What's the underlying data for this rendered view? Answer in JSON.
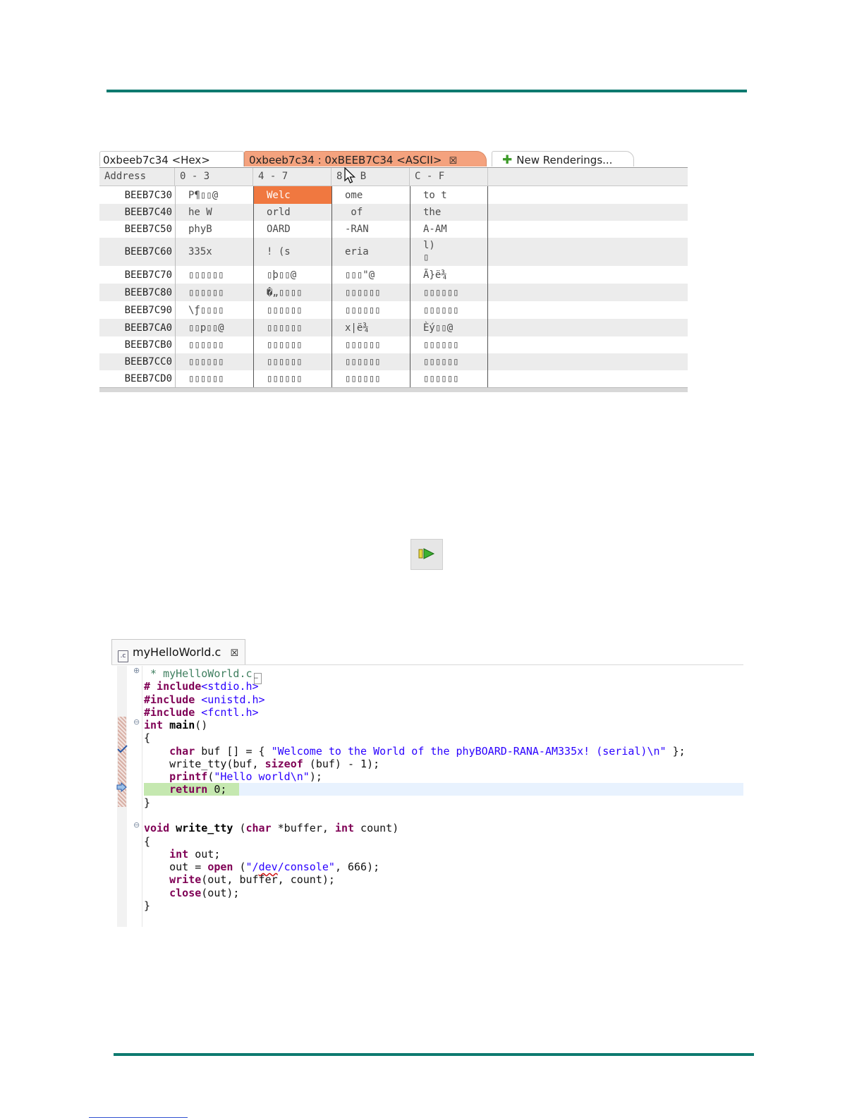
{
  "memory_view": {
    "tabs": [
      {
        "label": "0xbeeb7c34 <Hex>"
      },
      {
        "label": "0xbeeb7c34 : 0xBEEB7C34 <ASCII>"
      },
      {
        "label": "New Renderings..."
      }
    ],
    "columns": [
      "Address",
      "0 - 3",
      "4 - 7",
      "8 - B",
      "C - F"
    ],
    "rows": [
      {
        "address": "BEEB7C30",
        "c0": "P¶▯▯@",
        "c1": "Welc",
        "c2": "ome",
        "c3": "to t"
      },
      {
        "address": "BEEB7C40",
        "c0": "he W",
        "c1": "orld",
        "c2": " of",
        "c3": "the"
      },
      {
        "address": "BEEB7C50",
        "c0": "phyB",
        "c1": "OARD",
        "c2": "-RAN",
        "c3": "A-AM"
      },
      {
        "address": "BEEB7C60",
        "c0": "335x",
        "c1": "! (s",
        "c2": "eria",
        "c3": "l)\n▯"
      },
      {
        "address": "BEEB7C70",
        "c0": "▯▯▯▯▯▯",
        "c1": "▯þ▯▯@",
        "c2": "▯▯▯\"@",
        "c3": "Ã}ë¾"
      },
      {
        "address": "BEEB7C80",
        "c0": "▯▯▯▯▯▯",
        "c1": "�„▯▯▯▯",
        "c2": "▯▯▯▯▯▯",
        "c3": "▯▯▯▯▯▯"
      },
      {
        "address": "BEEB7C90",
        "c0": "\\ƒ▯▯▯▯",
        "c1": "▯▯▯▯▯▯",
        "c2": "▯▯▯▯▯▯",
        "c3": "▯▯▯▯▯▯"
      },
      {
        "address": "BEEB7CA0",
        "c0": "▯▯p▯▯@",
        "c1": "▯▯▯▯▯▯",
        "c2": "x|ë¾",
        "c3": "Èý▯▯@"
      },
      {
        "address": "BEEB7CB0",
        "c0": "▯▯▯▯▯▯",
        "c1": "▯▯▯▯▯▯",
        "c2": "▯▯▯▯▯▯",
        "c3": "▯▯▯▯▯▯"
      },
      {
        "address": "BEEB7CC0",
        "c0": "▯▯▯▯▯▯",
        "c1": "▯▯▯▯▯▯",
        "c2": "▯▯▯▯▯▯",
        "c3": "▯▯▯▯▯▯"
      },
      {
        "address": "BEEB7CD0",
        "c0": "▯▯▯▯▯▯",
        "c1": "▯▯▯▯▯▯",
        "c2": "▯▯▯▯▯▯",
        "c3": "▯▯▯▯▯▯"
      }
    ]
  },
  "editor": {
    "tab_label": "myHelloWorld.c",
    "file_icon": ".c",
    "lines": {
      "l1": " * myHelloWorld.c",
      "l2a": "# include",
      "l2b": "<stdio.h>",
      "l3a": "#include",
      "l3b": " <unistd.h>",
      "l4a": "#include",
      "l4b": " <fcntl.h>",
      "l5a": "int",
      "l5b": " main",
      "l5c": "()",
      "l6": "{",
      "l7a": "    char",
      "l7b": " buf [] = { ",
      "l7c": "\"Welcome to the World of the phyBOARD-RANA-AM335x! (serial)\\n\"",
      "l7d": " };",
      "l8a": "    write_tty(buf, ",
      "l8b": "sizeof",
      "l8c": " (buf) - 1);",
      "l9a": "    printf",
      "l9b": "(",
      "l9c": "\"Hello world\\n\"",
      "l9d": ");",
      "l10a": "    return",
      "l10b": " 0;",
      "l11": "}",
      "l13a": "void",
      "l13b": " write_tty",
      "l13c": " (",
      "l13d": "char",
      "l13e": " *buffer, ",
      "l13f": "int",
      "l13g": " count)",
      "l14": "{",
      "l15a": "    int",
      "l15b": " out;",
      "l16a": "    out = ",
      "l16b": "open",
      "l16c": " (",
      "l16d": "\"/",
      "l16e": "dev",
      "l16f": "/console\"",
      "l16g": ", 666);",
      "l17a": "    write",
      "l17b": "(out, buffer, count);",
      "l18a": "    close",
      "l18b": "(out);",
      "l19": "}"
    }
  },
  "colors": {
    "rule": "#0d7a6f",
    "selected_tab": "#f4a27e",
    "selected_cell": "#f07840",
    "keyword": "#7f0055",
    "string": "#2a00ff",
    "comment": "#3f7f5f"
  },
  "icons": [
    "add-rendering-icon",
    "close-tab-icon",
    "mouse-cursor-icon",
    "resume-icon",
    "c-file-icon",
    "breakpoint-icon",
    "instruction-pointer-icon",
    "fold-expand-icon",
    "fold-collapse-icon"
  ]
}
